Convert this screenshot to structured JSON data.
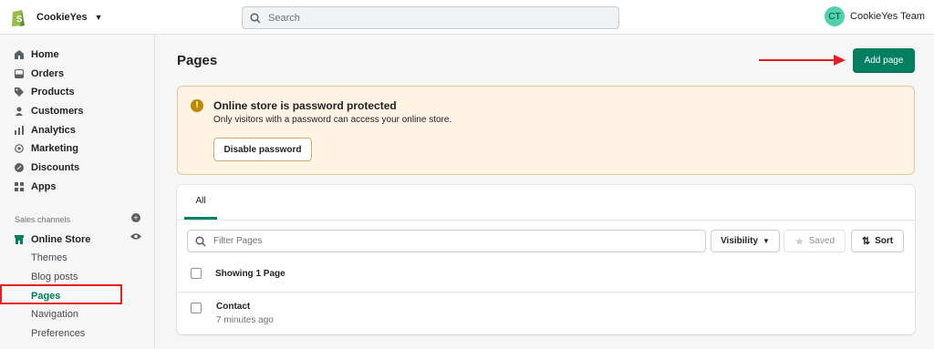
{
  "topbar": {
    "store_name": "CookieYes",
    "search_placeholder": "Search",
    "user_initials": "CT",
    "user_name": "CookieYes Team"
  },
  "sidebar": {
    "items": [
      {
        "label": "Home",
        "icon": "home-icon"
      },
      {
        "label": "Orders",
        "icon": "orders-icon"
      },
      {
        "label": "Products",
        "icon": "tag-icon"
      },
      {
        "label": "Customers",
        "icon": "person-icon"
      },
      {
        "label": "Analytics",
        "icon": "bar-chart-icon"
      },
      {
        "label": "Marketing",
        "icon": "target-icon"
      },
      {
        "label": "Discounts",
        "icon": "discount-icon"
      },
      {
        "label": "Apps",
        "icon": "apps-icon"
      }
    ],
    "sales_channels_label": "Sales channels",
    "online_store_label": "Online Store",
    "sub_items": [
      "Themes",
      "Blog posts",
      "Pages",
      "Navigation",
      "Preferences"
    ]
  },
  "main": {
    "title": "Pages",
    "add_button": "Add page",
    "banner": {
      "title": "Online store is password protected",
      "text": "Only visitors with a password can access your online store.",
      "button": "Disable password"
    },
    "tabs": [
      "All"
    ],
    "filter_placeholder": "Filter Pages",
    "visibility_label": "Visibility",
    "saved_label": "Saved",
    "sort_label": "Sort",
    "showing_label": "Showing 1 Page",
    "rows": [
      {
        "title": "Contact",
        "subtitle": "7 minutes ago"
      }
    ]
  },
  "colors": {
    "accent": "#008060",
    "annotation": "#e31e24",
    "banner_bg": "#fff4e4"
  }
}
